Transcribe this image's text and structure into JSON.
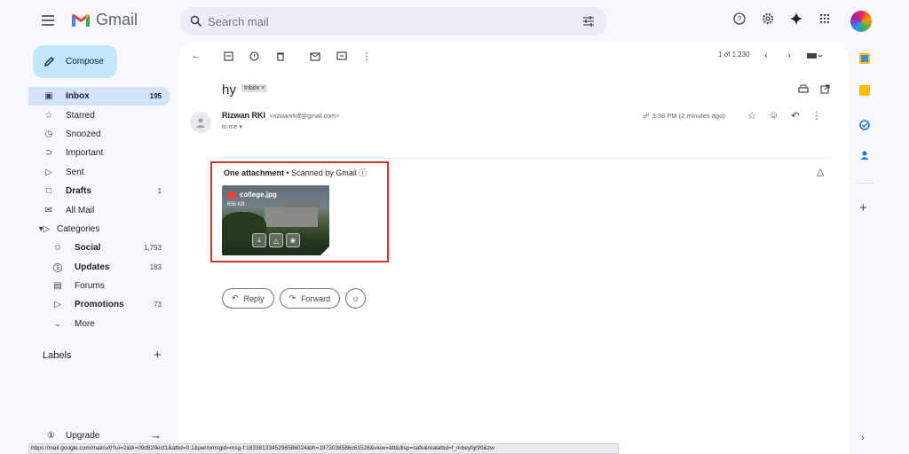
{
  "app": {
    "name": "Gmail"
  },
  "search": {
    "placeholder": "Search mail"
  },
  "compose_label": "Compose",
  "nav": [
    {
      "label": "Inbox",
      "count": "195",
      "icon": "inbox-icon"
    },
    {
      "label": "Starred",
      "count": "",
      "icon": "star-icon"
    },
    {
      "label": "Snoozed",
      "count": "",
      "icon": "clock-icon"
    },
    {
      "label": "Important",
      "count": "",
      "icon": "important-icon"
    },
    {
      "label": "Sent",
      "count": "",
      "icon": "send-icon"
    },
    {
      "label": "Drafts",
      "count": "1",
      "icon": "draft-icon"
    },
    {
      "label": "All Mail",
      "count": "",
      "icon": "all-mail-icon"
    },
    {
      "label": "Categories",
      "count": "",
      "icon": "label-icon"
    },
    {
      "label": "Social",
      "count": "1,793",
      "icon": "people-icon"
    },
    {
      "label": "Updates",
      "count": "183",
      "icon": "info-icon"
    },
    {
      "label": "Forums",
      "count": "",
      "icon": "forum-icon"
    },
    {
      "label": "Promotions",
      "count": "73",
      "icon": "tag-icon"
    },
    {
      "label": "More",
      "count": "",
      "icon": "chevron-down-icon"
    }
  ],
  "labels_heading": "Labels",
  "upgrade_label": "Upgrade",
  "pager": {
    "text": "1 of 1,230"
  },
  "email": {
    "subject": "hy",
    "folder_chip": "Inbox ×",
    "sender_name": "Rizwan RKI",
    "sender_email": "<rizwanrkiff@gmail.com>",
    "to": "to me ▾",
    "time": "3:38 PM (2 minutes ago)"
  },
  "attachment": {
    "title": "One attachment",
    "scanned": "• Scanned by Gmail",
    "file_name": "college.jpg",
    "file_size": "658 KB"
  },
  "actions": {
    "reply": "Reply",
    "forward": "Forward"
  },
  "status_url": "https://mail.google.com/mail/u/0?ui=2&ik=09d829ecf1&attid=0.1&permmsgid=msg-f:1833813345296586024&th=1973038586c61528&view=att&disp=safe&realattid=f_mbeyhjr90&zw",
  "colors": {
    "accent": "#0b57d0",
    "active_nav": "#d3e3fd",
    "compose_bg": "#c2e7ff",
    "highlight_box": "#d93025"
  }
}
